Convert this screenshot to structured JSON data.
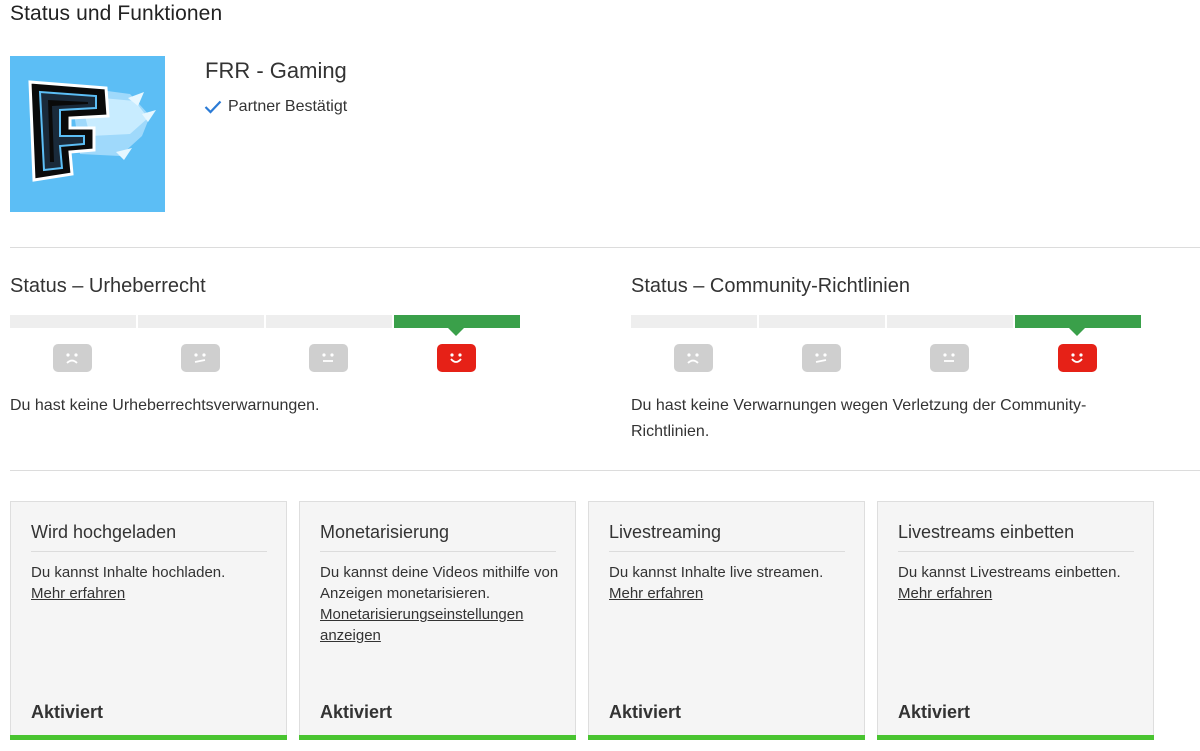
{
  "page": {
    "title": "Status und Funktionen"
  },
  "channel": {
    "name": "FRR - Gaming",
    "partner_label": "Partner Bestätigt",
    "avatar_icon": "frr-gaming-logo",
    "avatar_color": "#5cbef5"
  },
  "copyright": {
    "title": "Status – Urheberrecht",
    "message": "Du hast keine Urheberrechtsverwarnungen.",
    "active_level": 4,
    "levels": [
      "sad-face-icon",
      "neutral-face-icon",
      "neutral-face-icon",
      "happy-face-icon"
    ]
  },
  "community": {
    "title": "Status – Community-Richtlinien",
    "message_line1": "Du hast keine Verwarnungen wegen Verletzung der Community-",
    "message_line2": "Richtlinien.",
    "active_level": 4,
    "levels": [
      "sad-face-icon",
      "neutral-face-icon",
      "neutral-face-icon",
      "happy-face-icon"
    ]
  },
  "colors": {
    "active_status": "#3aa04a",
    "active_face": "#e62117",
    "inactive_face": "#cfcfcf",
    "enabled_bar": "#49c430"
  },
  "features": [
    {
      "title": "Wird hochgeladen",
      "text": "Du kannst Inhalte hochladen.",
      "link": "Mehr erfahren",
      "status": "Aktiviert"
    },
    {
      "title": "Monetarisierung",
      "text": "Du kannst deine Videos mithilfe von Anzeigen monetarisieren.",
      "link": "Monetarisierungseinstellungen anzeigen",
      "status": "Aktiviert"
    },
    {
      "title": "Livestreaming",
      "text": "Du kannst Inhalte live streamen.",
      "link": "Mehr erfahren",
      "status": "Aktiviert"
    },
    {
      "title": "Livestreams einbetten",
      "text": "Du kannst Livestreams einbetten.",
      "link": "Mehr erfahren",
      "status": "Aktiviert"
    }
  ]
}
